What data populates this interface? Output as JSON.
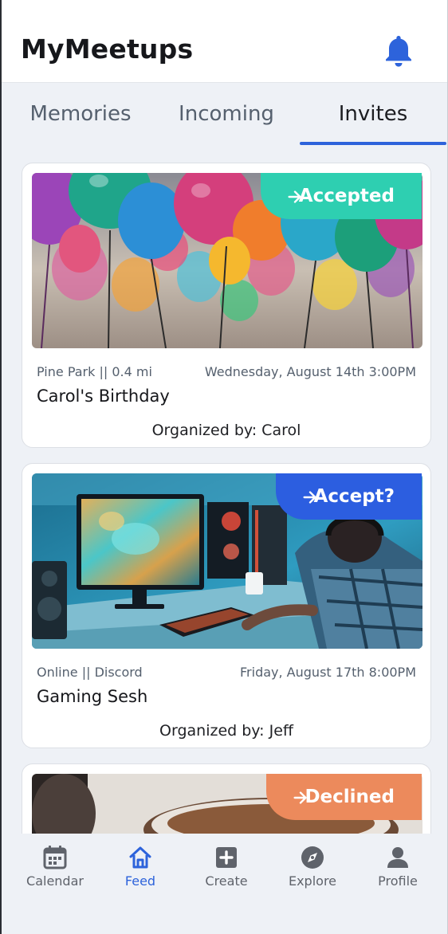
{
  "header": {
    "title": "MyMeetups"
  },
  "tabs": [
    {
      "label": "Memories"
    },
    {
      "label": "Incoming"
    },
    {
      "label": "Invites"
    }
  ],
  "events": [
    {
      "status": "Accepted",
      "status_color": "#2ecfb1",
      "location": "Pine Park || 0.4 mi",
      "datetime": "Wednesday, August 14th  3:00PM",
      "title": "Carol's Birthday",
      "organizer": "Organized by: Carol",
      "image_icon": "party-balloons-photo"
    },
    {
      "status": "Accept?",
      "status_color": "#2c5ee0",
      "location": "Online || Discord",
      "datetime": "Friday, August 17th 8:00PM",
      "title": "Gaming Sesh",
      "organizer": "Organized by: Jeff",
      "image_icon": "gaming-setup-photo"
    },
    {
      "status": "Declined",
      "status_color": "#ec8a5c",
      "image_icon": "coffee-cup-photo"
    }
  ],
  "nav": [
    {
      "label": "Calendar",
      "icon": "calendar-icon"
    },
    {
      "label": "Feed",
      "icon": "home-icon"
    },
    {
      "label": "Create",
      "icon": "add-box-icon"
    },
    {
      "label": "Explore",
      "icon": "compass-icon"
    },
    {
      "label": "Profile",
      "icon": "person-icon"
    }
  ],
  "colors": {
    "accent": "#2d63db",
    "inactive": "#5f636b"
  }
}
